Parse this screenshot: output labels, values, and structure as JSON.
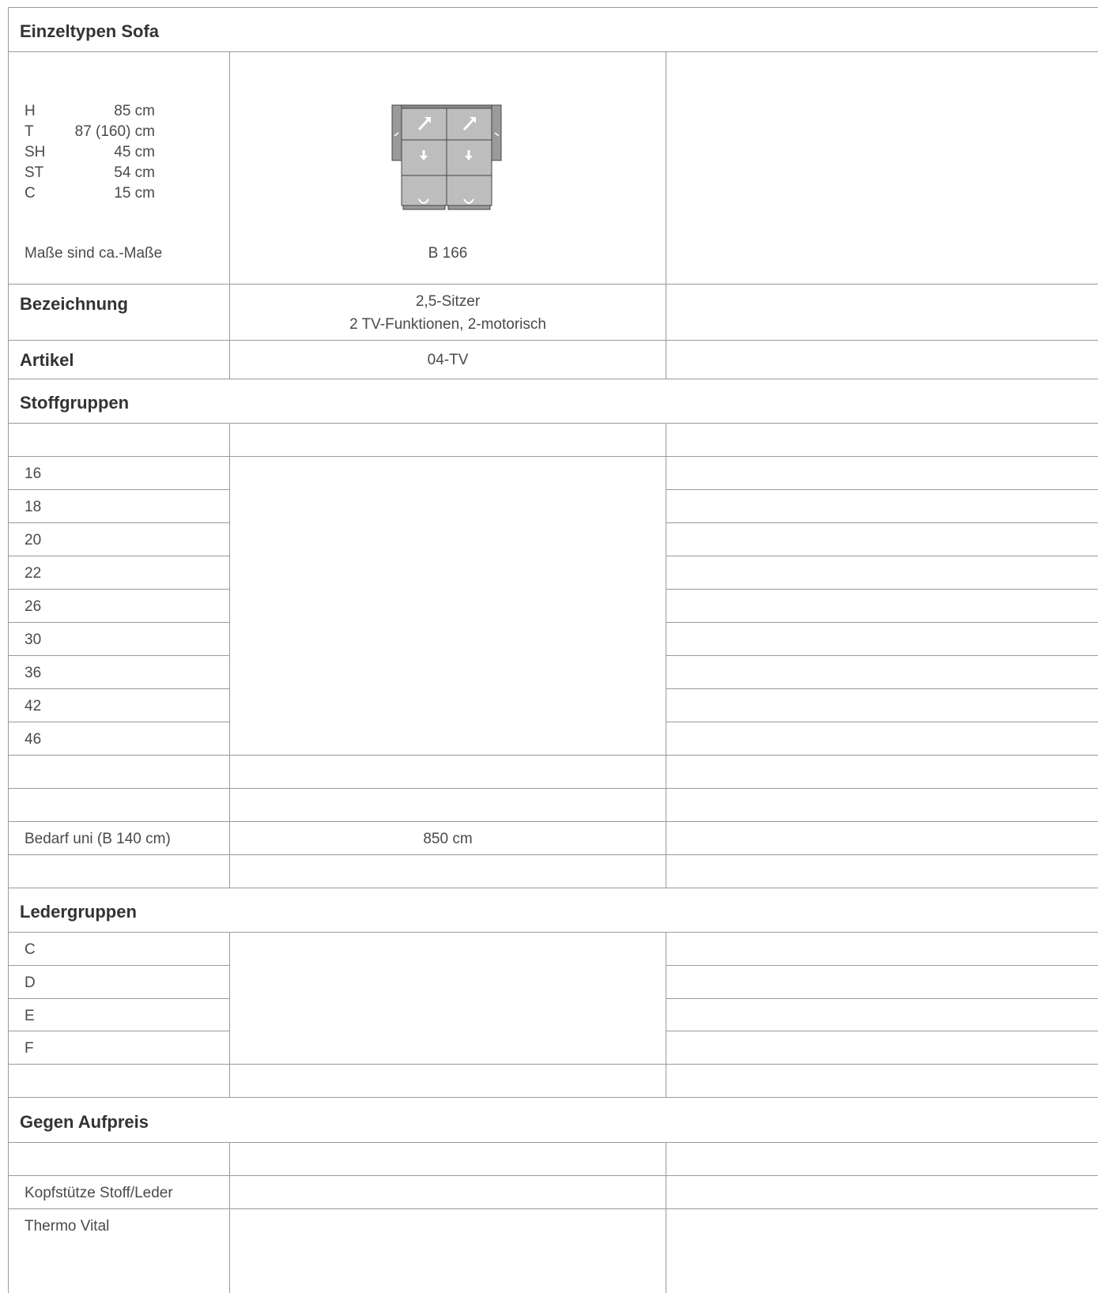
{
  "header": {
    "title": "Einzeltypen Sofa"
  },
  "dimensions": {
    "items": [
      {
        "key": "H",
        "value": "85 cm"
      },
      {
        "key": "T",
        "value": "87 (160) cm"
      },
      {
        "key": "SH",
        "value": "45 cm"
      },
      {
        "key": "ST",
        "value": "54 cm"
      },
      {
        "key": "C",
        "value": "15 cm"
      }
    ],
    "note": "Maße sind ca.-Maße",
    "width_label": "B 166"
  },
  "bezeichnung": {
    "label": "Bezeichnung",
    "line1": "2,5-Sitzer",
    "line2": "2 TV-Funktionen, 2-motorisch"
  },
  "artikel": {
    "label": "Artikel",
    "value": "04-TV"
  },
  "stoffgruppen": {
    "title": "Stoffgruppen",
    "groups": [
      "16",
      "18",
      "20",
      "22",
      "26",
      "30",
      "36",
      "42",
      "46"
    ],
    "bedarf_label": "Bedarf uni (B 140 cm)",
    "bedarf_value": "850 cm"
  },
  "ledergruppen": {
    "title": "Ledergruppen",
    "groups": [
      "C",
      "D",
      "E",
      "F"
    ]
  },
  "aufpreis": {
    "title": "Gegen Aufpreis",
    "items": [
      "Kopfstütze Stoff/Leder",
      "Thermo Vital"
    ]
  },
  "colors": {
    "line": "#9a9a9a",
    "text": "#3a3a3a",
    "sofa_fill": "#bdbdbd",
    "sofa_arm": "#9a9a9a"
  }
}
